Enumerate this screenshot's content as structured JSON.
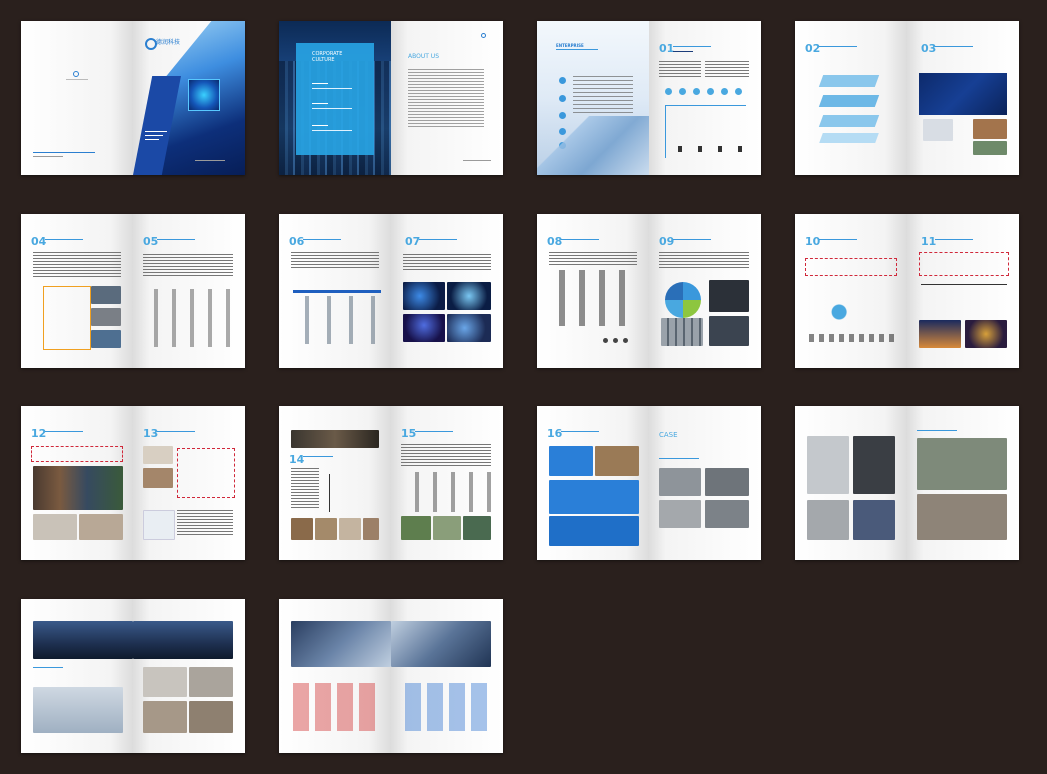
{
  "spreads": [
    {
      "id": "cover",
      "company": "德润科技"
    },
    {
      "id": "culture",
      "culture_title": "CORPORATE\nCULTURE",
      "about_title": "ABOUT US"
    },
    {
      "id": "enterprise",
      "enterprise_title": "ENTERPRISE",
      "section": "01"
    },
    {
      "id": "s02-03",
      "sections": [
        "02",
        "03"
      ]
    },
    {
      "id": "s04-05",
      "sections": [
        "04",
        "05"
      ]
    },
    {
      "id": "s06-07",
      "sections": [
        "06",
        "07"
      ]
    },
    {
      "id": "s08-09",
      "sections": [
        "08",
        "09"
      ]
    },
    {
      "id": "s10-11",
      "sections": [
        "10",
        "11"
      ]
    },
    {
      "id": "s12-13",
      "sections": [
        "12",
        "13"
      ]
    },
    {
      "id": "s14-15",
      "sections": [
        "14",
        "15"
      ]
    },
    {
      "id": "s16-case",
      "sections": [
        "16"
      ],
      "case_title": "CASE"
    },
    {
      "id": "photos-1"
    },
    {
      "id": "photos-2"
    },
    {
      "id": "partners"
    }
  ]
}
